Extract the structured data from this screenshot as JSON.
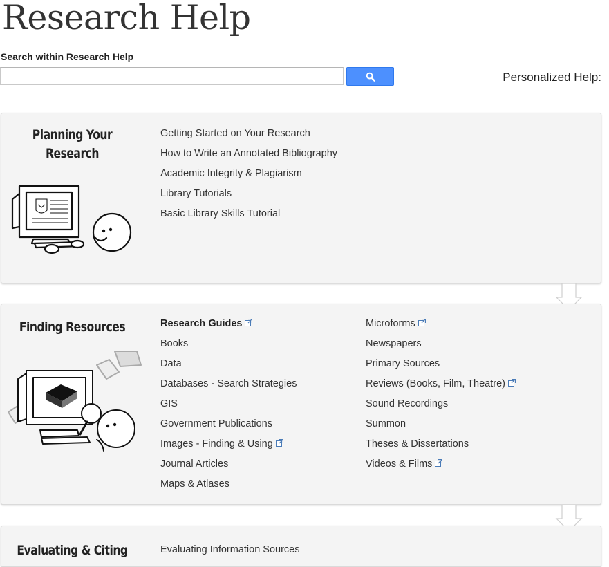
{
  "header": {
    "title": "Research Help"
  },
  "search": {
    "label": "Search within Research Help",
    "placeholder": "",
    "value": "",
    "button_icon": "search-icon",
    "accent_color": "#4d90fe"
  },
  "personalized_help": {
    "label": "Personalized Help:"
  },
  "sections": [
    {
      "title_line1": "Planning Your",
      "title_line2": "Research",
      "illustration": "computer-with-smiley-icon",
      "links": [
        {
          "label": "Getting Started on Your Research"
        },
        {
          "label": "How to Write an Annotated Bibliography"
        },
        {
          "label": "Academic Integrity & Plagiarism"
        },
        {
          "label": "Library Tutorials"
        },
        {
          "label": "Basic Library Skills Tutorial"
        }
      ]
    },
    {
      "title_line1": "Finding Resources",
      "illustration": "computer-books-magnifier-icon",
      "links_col1": [
        {
          "label": "Research Guides",
          "bold": true,
          "external": true
        },
        {
          "label": "Books"
        },
        {
          "label": "Data"
        },
        {
          "label": "Databases - Search Strategies"
        },
        {
          "label": "GIS"
        },
        {
          "label": "Government Publications"
        },
        {
          "label": "Images - Finding & Using",
          "external": true
        },
        {
          "label": "Journal Articles"
        },
        {
          "label": "Maps & Atlases"
        }
      ],
      "links_col2": [
        {
          "label": "Microforms",
          "external": true
        },
        {
          "label": "Newspapers"
        },
        {
          "label": "Primary Sources"
        },
        {
          "label": "Reviews (Books, Film, Theatre)",
          "external": true
        },
        {
          "label": "Sound Recordings"
        },
        {
          "label": "Summon"
        },
        {
          "label": "Theses & Dissertations"
        },
        {
          "label": "Videos & Films",
          "external": true
        }
      ]
    },
    {
      "title_line1": "Evaluating & Citing",
      "links": [
        {
          "label": "Evaluating Information Sources"
        }
      ]
    }
  ]
}
